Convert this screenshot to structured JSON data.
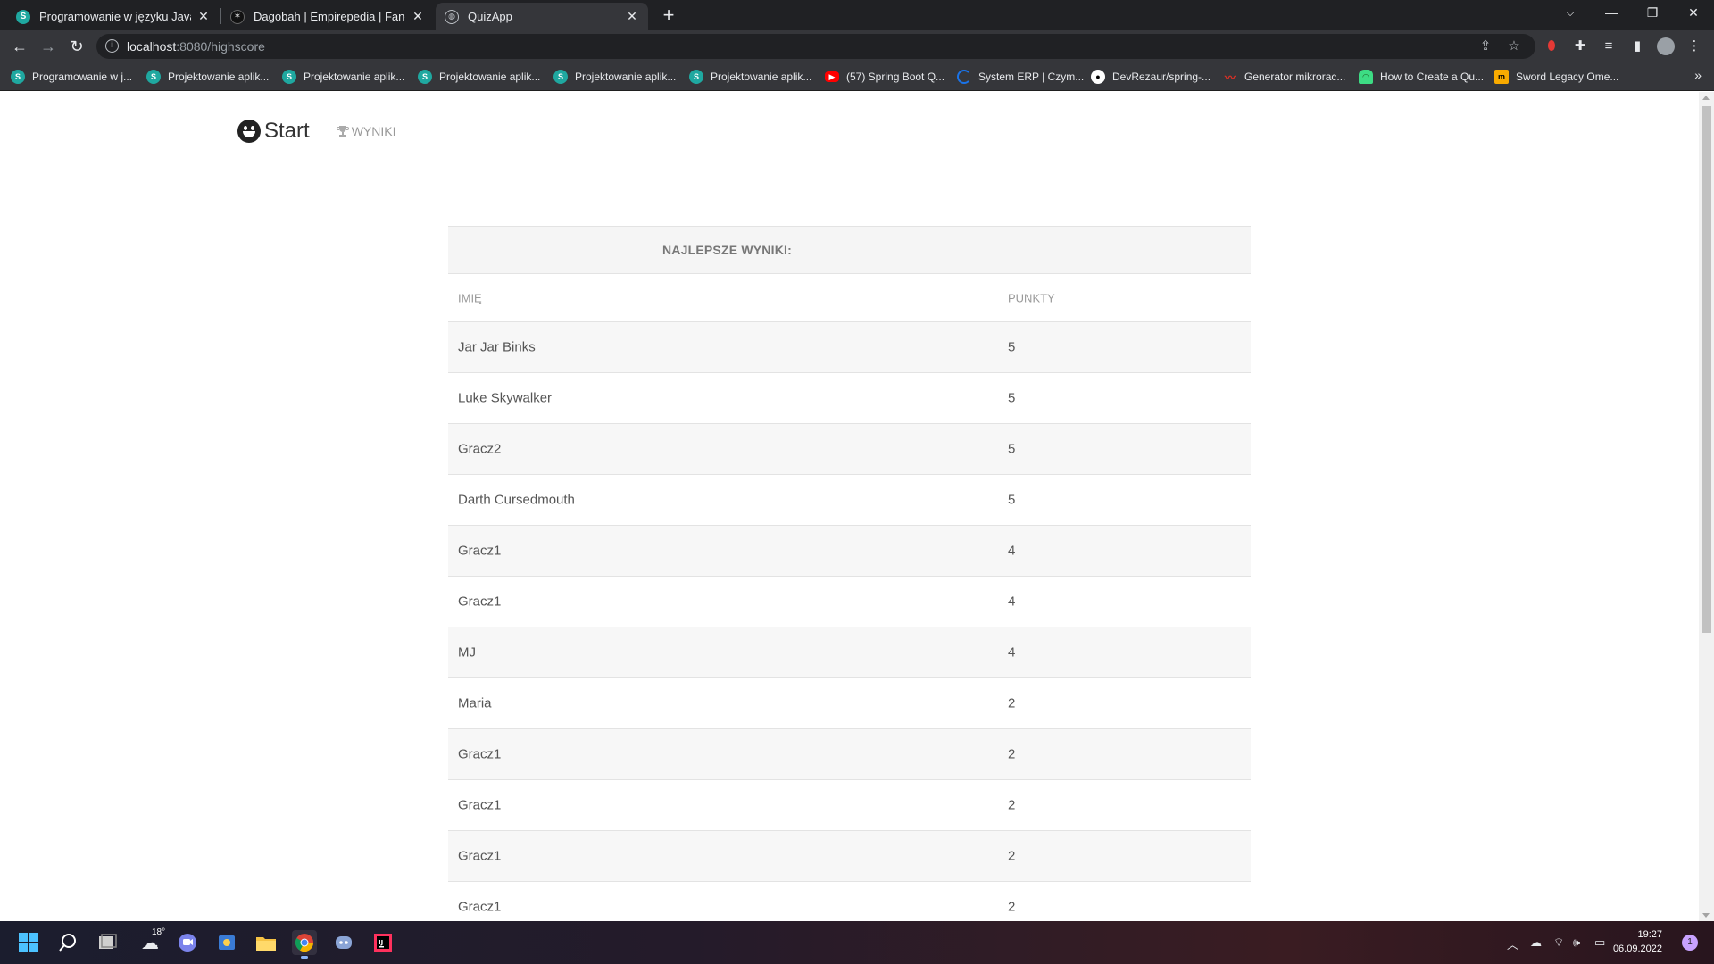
{
  "browser": {
    "tabs": [
      {
        "title": "Programowanie w języku Java [I]",
        "favicon": "s-badge-icon"
      },
      {
        "title": "Dagobah | Empirepedia | Fandom",
        "favicon": "fandom-icon"
      },
      {
        "title": "QuizApp",
        "favicon": "globe-icon"
      }
    ],
    "url_host": "localhost",
    "url_rest": ":8080/highscore",
    "bookmarks": [
      {
        "label": "Programowanie w j...",
        "icon": "s-badge-icon",
        "color": "#1fa8a0"
      },
      {
        "label": "Projektowanie aplik...",
        "icon": "s-badge-icon",
        "color": "#1fa8a0"
      },
      {
        "label": "Projektowanie aplik...",
        "icon": "s-badge-icon",
        "color": "#1fa8a0"
      },
      {
        "label": "Projektowanie aplik...",
        "icon": "s-badge-icon",
        "color": "#1fa8a0"
      },
      {
        "label": "Projektowanie aplik...",
        "icon": "s-badge-icon",
        "color": "#1fa8a0"
      },
      {
        "label": "Projektowanie aplik...",
        "icon": "s-badge-icon",
        "color": "#1fa8a0"
      },
      {
        "label": "(57) Spring Boot Q...",
        "icon": "youtube-icon",
        "color": "#ff0000"
      },
      {
        "label": "System ERP | Czym...",
        "icon": "crescent-icon",
        "color": "#1a73e8"
      },
      {
        "label": "DevRezaur/spring-...",
        "icon": "github-icon",
        "color": "#ffffff"
      },
      {
        "label": "Generator mikrorac...",
        "icon": "chart-icon",
        "color": "#d93025"
      },
      {
        "label": "How to Create a Qu...",
        "icon": "android-icon",
        "color": "#3ddc84"
      },
      {
        "label": "Sword Legacy Ome...",
        "icon": "m-logo-icon",
        "color": "#f9ab00"
      }
    ]
  },
  "app": {
    "brand": "Start",
    "nav_scores": "WYNIKI",
    "table_title": "NAJLEPSZE WYNIKI:",
    "col_name": "IMIĘ",
    "col_points": "PUNKTY",
    "rows": [
      {
        "name": "Jar Jar Binks",
        "points": "5"
      },
      {
        "name": "Luke Skywalker",
        "points": "5"
      },
      {
        "name": "Gracz2",
        "points": "5"
      },
      {
        "name": "Darth Cursedmouth",
        "points": "5"
      },
      {
        "name": "Gracz1",
        "points": "4"
      },
      {
        "name": "Gracz1",
        "points": "4"
      },
      {
        "name": "MJ",
        "points": "4"
      },
      {
        "name": "Maria",
        "points": "2"
      },
      {
        "name": "Gracz1",
        "points": "2"
      },
      {
        "name": "Gracz1",
        "points": "2"
      },
      {
        "name": "Gracz1",
        "points": "2"
      },
      {
        "name": "Gracz1",
        "points": "2"
      }
    ]
  },
  "taskbar": {
    "weather_temp": "18°",
    "time": "19:27",
    "date": "06.09.2022",
    "notifications": "1"
  }
}
